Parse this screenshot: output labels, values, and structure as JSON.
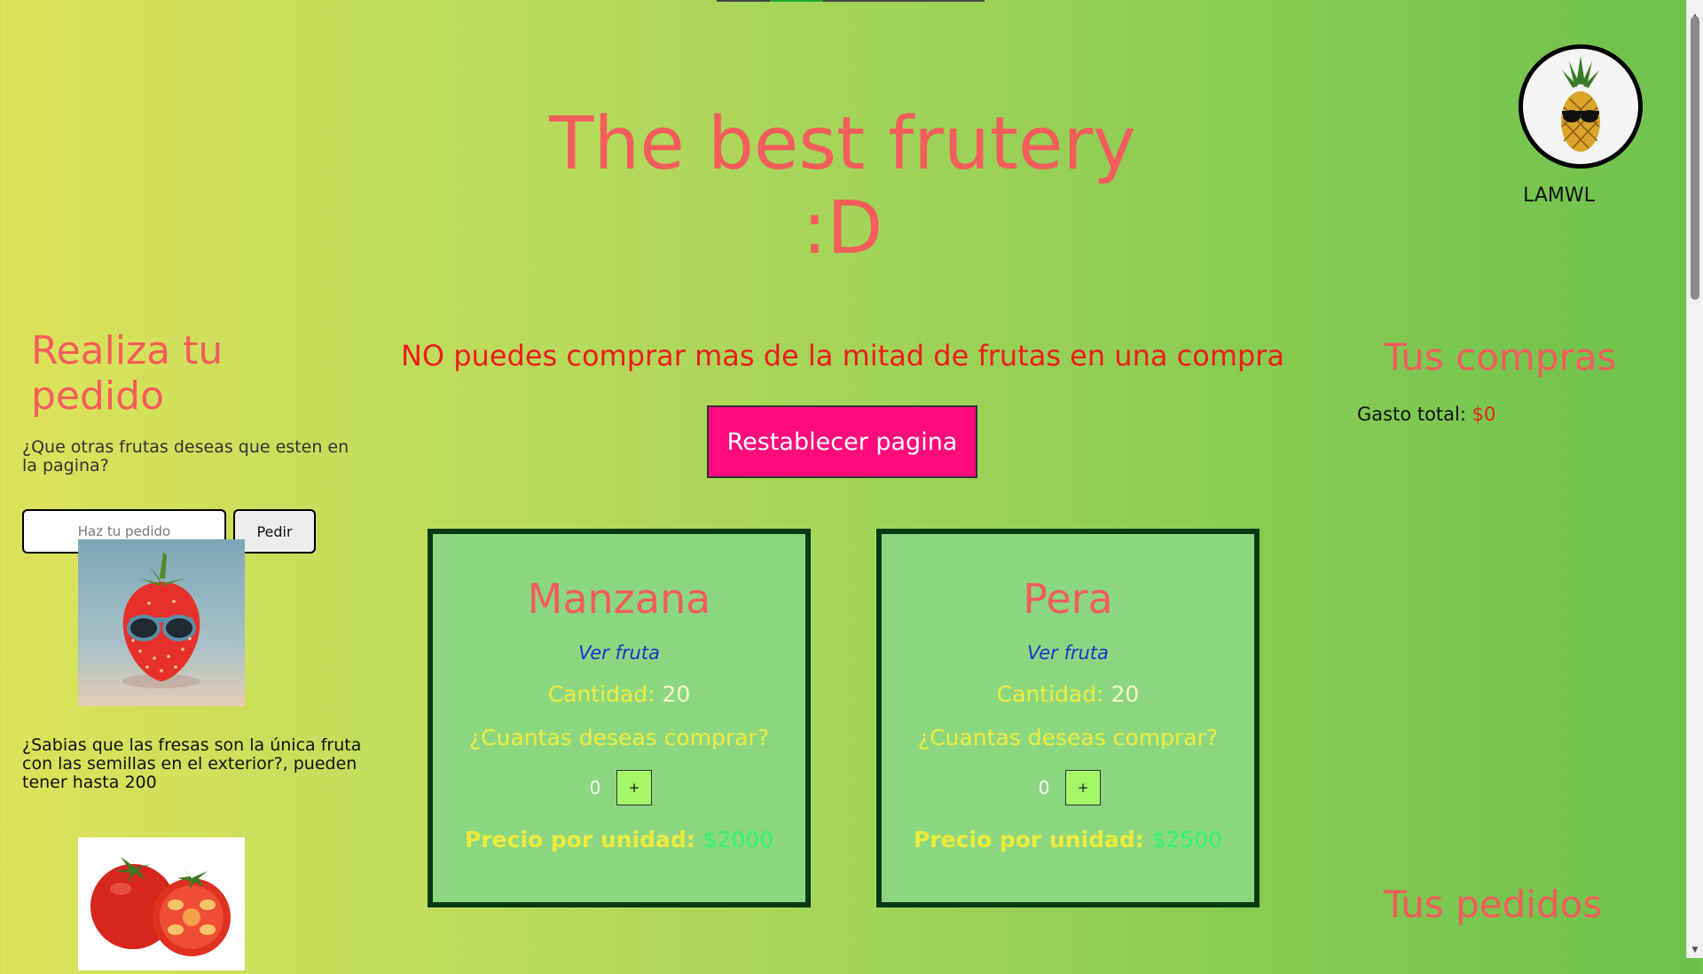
{
  "header": {
    "title": "The best frutery :D",
    "profile_name": "LAMWL"
  },
  "left": {
    "title": "Realiza tu pedido",
    "question": "¿Que otras frutas deseas que esten en la pagina?",
    "input_placeholder": "Haz tu pedido",
    "order_button": "Pedir",
    "fact": "¿Sabias que las fresas son la única fruta con las semillas en el exterior?, pueden tener hasta 200"
  },
  "center": {
    "warning": "NO puedes comprar mas de la mitad de frutas en una compra",
    "reset_button": "Restablecer pagina",
    "cards": [
      {
        "name": "Manzana",
        "link": "Ver fruta",
        "qty_label": "Cantidad:",
        "qty_value": "20",
        "ask": "¿Cuantas deseas comprar?",
        "selected": "0",
        "plus": "+",
        "price_label": "Precio por unidad:",
        "price_value": "$2000"
      },
      {
        "name": "Pera",
        "link": "Ver fruta",
        "qty_label": "Cantidad:",
        "qty_value": "20",
        "ask": "¿Cuantas deseas comprar?",
        "selected": "0",
        "plus": "+",
        "price_label": "Precio por unidad:",
        "price_value": "$2500"
      }
    ]
  },
  "right": {
    "title": "Tus compras",
    "spend_label": "Gasto total:",
    "spend_value": "$0",
    "orders_title": "Tus pedidos"
  },
  "colors": {
    "accent_title": "#f55c5c",
    "reset_button": "#ff0b7c",
    "card_bg": "#8bd780",
    "card_border": "#083a12",
    "warning": "#ef1c1c"
  },
  "icons": {
    "avatar": "pineapple-with-sunglasses-icon",
    "strawberry": "strawberry-with-sunglasses-image",
    "tomato": "tomato-image"
  }
}
